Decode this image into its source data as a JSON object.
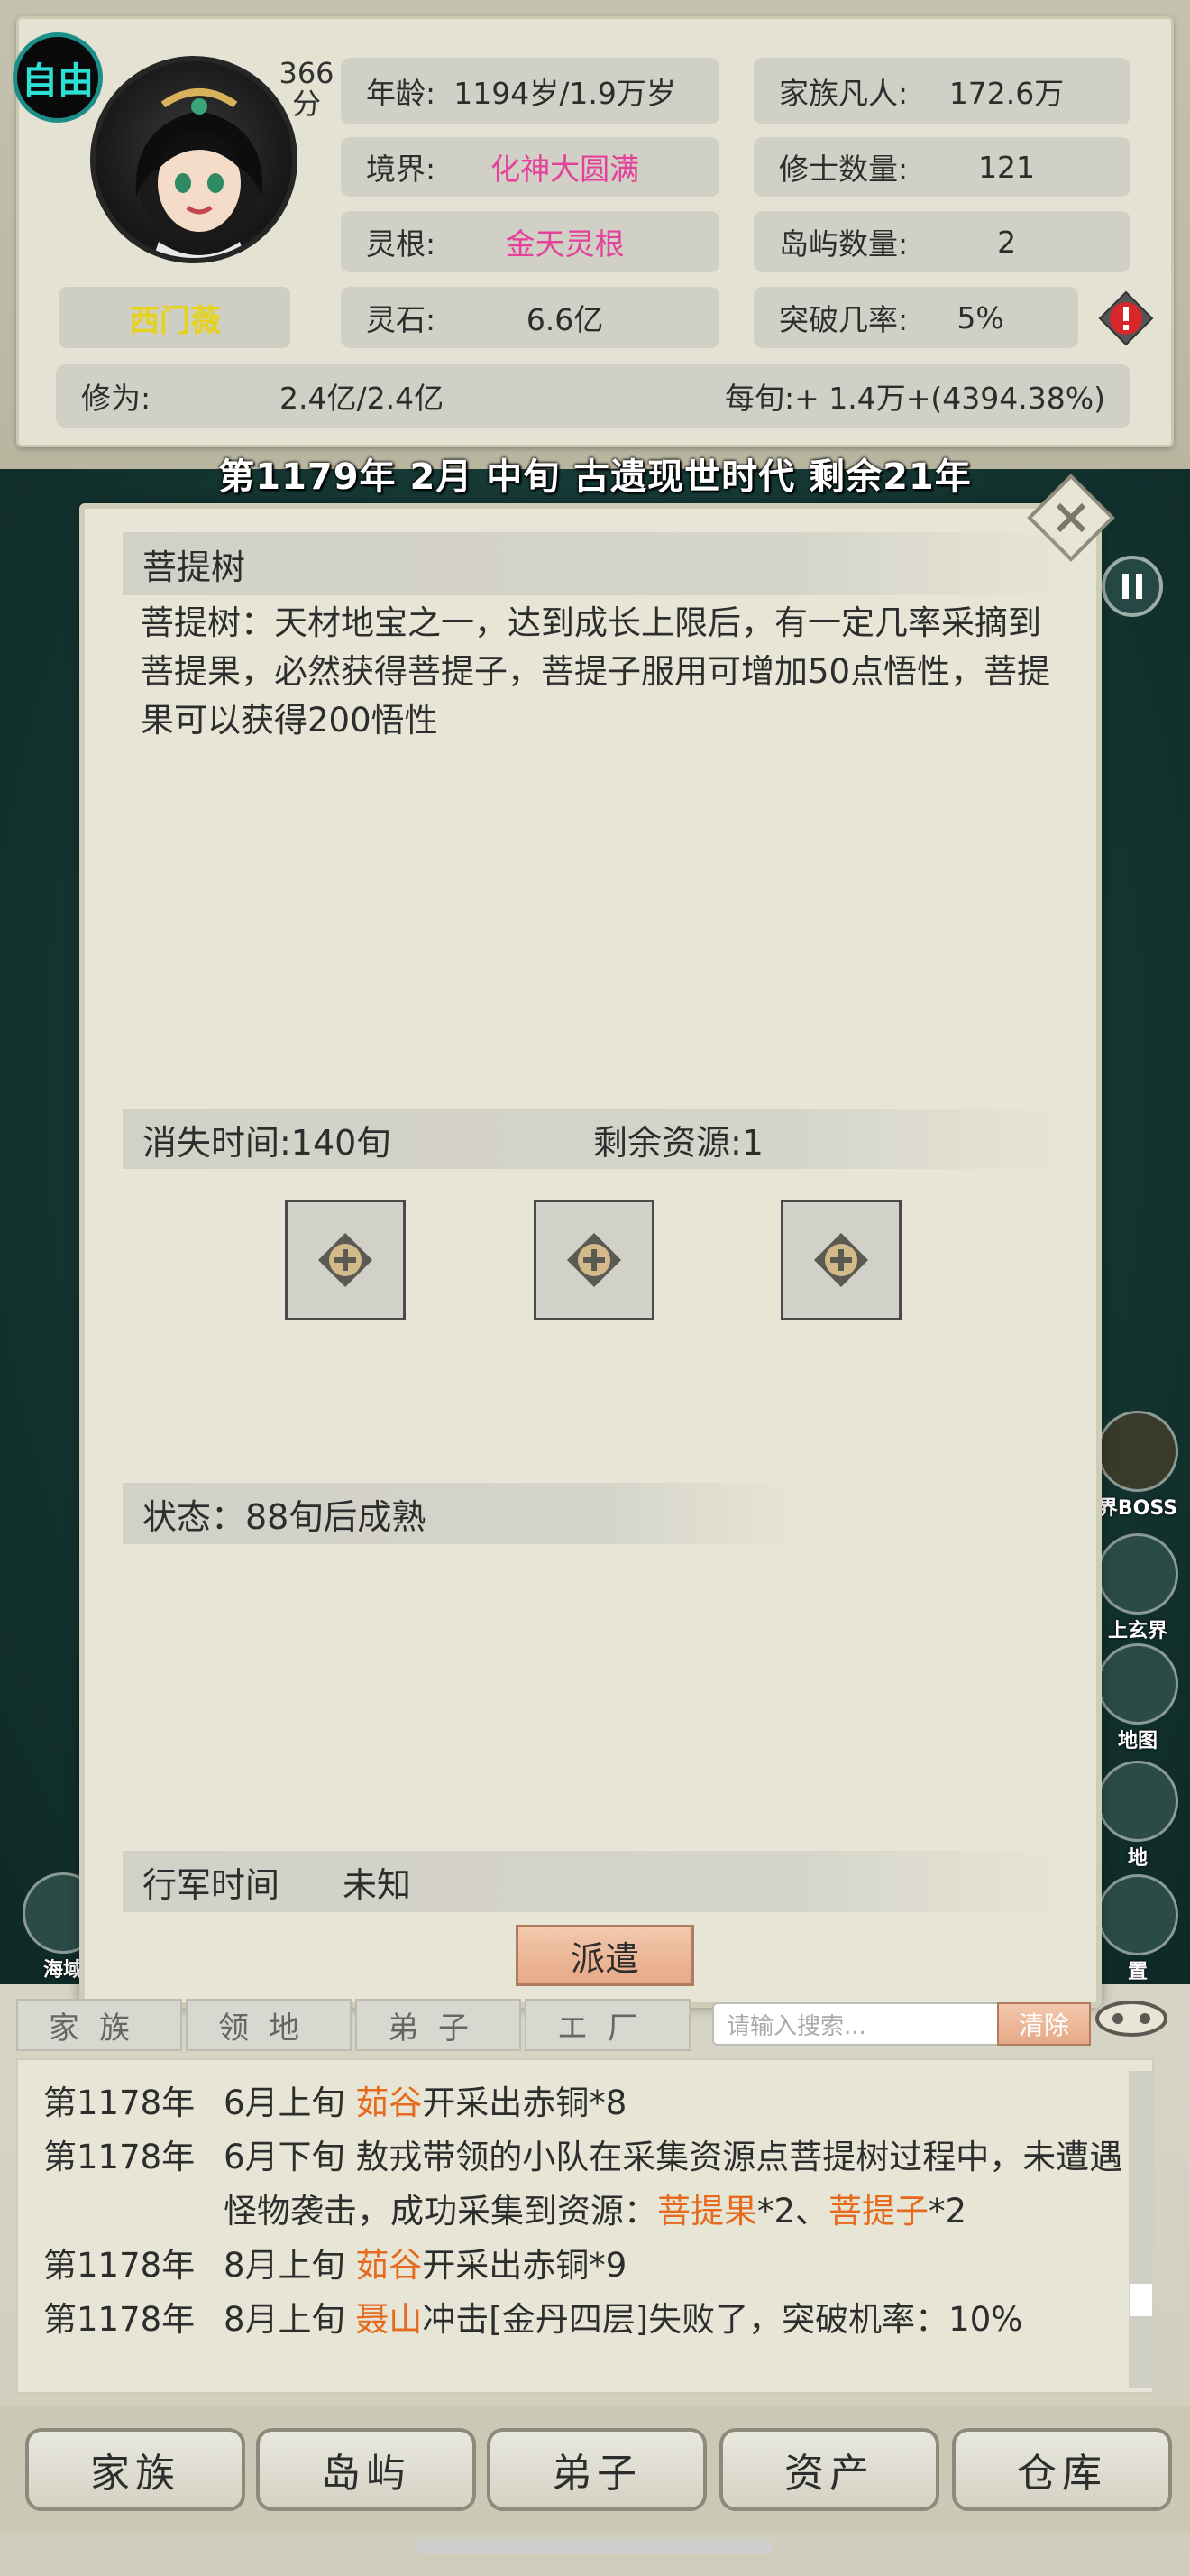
{
  "status": {
    "free_badge": "自由",
    "score_value": "366",
    "score_unit": "分",
    "character_name": "西门薇",
    "age_label": "年龄:",
    "age_value": "1194岁/1.9万岁",
    "realm_label": "境界:",
    "realm_value": "化神大圆满",
    "root_label": "灵根:",
    "root_value": "金天灵根",
    "stones_label": "灵石:",
    "stones_value": "6.6亿",
    "mortals_label": "家族凡人:",
    "mortals_value": "172.6万",
    "cultivators_label": "修士数量:",
    "cultivators_value": "121",
    "islands_label": "岛屿数量:",
    "islands_value": "2",
    "breakthrough_label": "突破几率:",
    "breakthrough_value": "5%",
    "cultivation_label": "修为:",
    "cultivation_value": "2.4亿/2.4亿",
    "per_xun_value": "每旬:+ 1.4万+(4394.38%)"
  },
  "date_bar": "第1179年 2月 中旬  古遗现世时代 剩余21年",
  "modal": {
    "title": "菩提树",
    "description": "菩提树：天材地宝之一，达到成长上限后，有一定几率采摘到菩提果，必然获得菩提子，菩提子服用可增加50点悟性，菩提果可以获得200悟性",
    "vanish_time": "消失时间:140旬",
    "remaining_resources": "剩余资源:1",
    "state": "状态：88旬后成熟",
    "march_label": "行军时间",
    "march_value": "未知",
    "dispatch_button": "派遣"
  },
  "side_icons": [
    {
      "label": "界BOSS",
      "icon": "demon-icon"
    },
    {
      "label": "上玄界",
      "icon": "mountain-icon"
    },
    {
      "label": "地图",
      "icon": "map-pin-icon"
    },
    {
      "label": "地",
      "icon": "island-icon"
    },
    {
      "label": "置",
      "icon": "gear-icon"
    },
    {
      "label": "海域",
      "icon": "sea-icon"
    }
  ],
  "log_tabs": [
    "家族",
    "领地",
    "弟子",
    "エ厂"
  ],
  "log_search_placeholder": "请输入搜索...",
  "log_clear": "清除",
  "log_lines": [
    {
      "date": "第1178年",
      "segments": [
        {
          "text": "6月上旬 ",
          "hl": false
        },
        {
          "text": "茹谷",
          "hl": true
        },
        {
          "text": "开采出赤铜*8",
          "hl": false
        }
      ]
    },
    {
      "date": "第1178年",
      "segments": [
        {
          "text": "6月下旬 敖戎带领的小队在采集资源点菩提树过程中，未遭遇怪物袭击，成功采集到资源：",
          "hl": false
        },
        {
          "text": "菩提果",
          "hl": true
        },
        {
          "text": "*2、",
          "hl": false
        },
        {
          "text": "菩提子",
          "hl": true
        },
        {
          "text": "*2",
          "hl": false
        }
      ]
    },
    {
      "date": "第1178年",
      "segments": [
        {
          "text": "8月上旬 ",
          "hl": false
        },
        {
          "text": "茹谷",
          "hl": true
        },
        {
          "text": "开采出赤铜*9",
          "hl": false
        }
      ]
    },
    {
      "date": "第1178年",
      "segments": [
        {
          "text": "8月上旬 ",
          "hl": false
        },
        {
          "text": "聂山",
          "hl": true
        },
        {
          "text": "冲击[金丹四层]失败了，突破机率：10%",
          "hl": false
        }
      ]
    }
  ],
  "nav": [
    "家族",
    "岛屿",
    "弟子",
    "资产",
    "仓库"
  ],
  "colors": {
    "accent_pink": "#e5409a",
    "log_highlight": "#e56a1e",
    "name_yellow": "#e5d21a",
    "free_badge_cyan": "#2de0d5"
  }
}
